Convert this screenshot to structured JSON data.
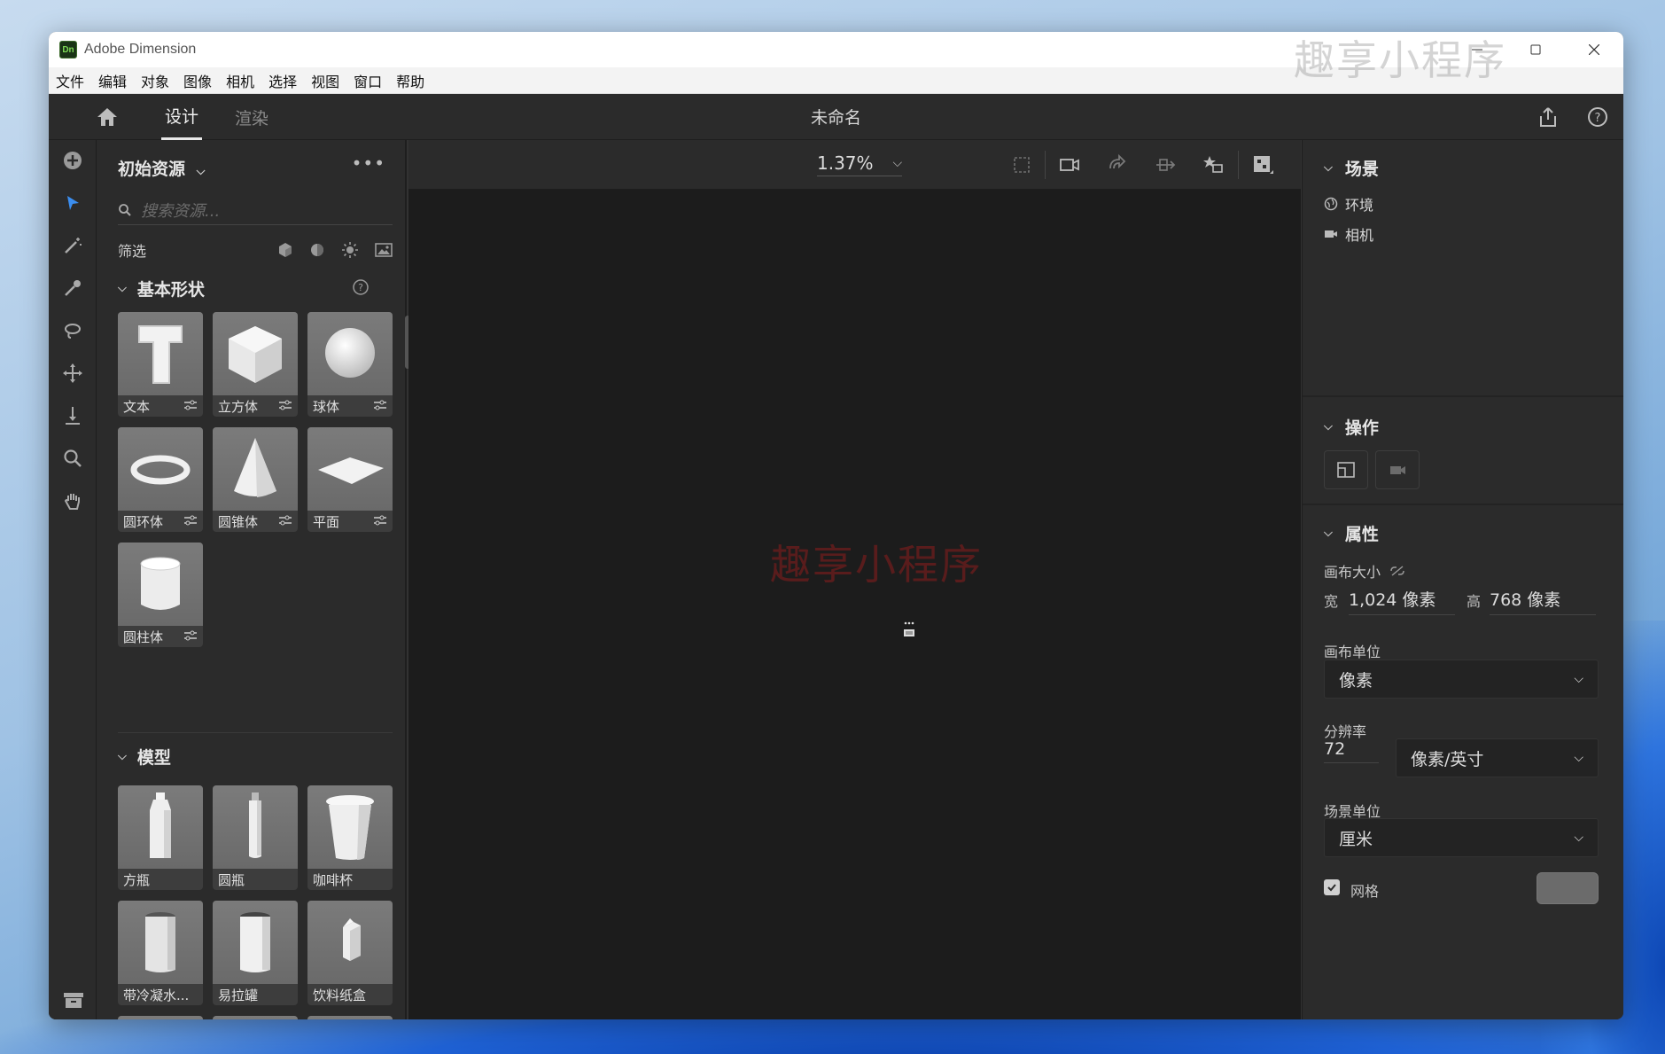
{
  "window": {
    "app_title": "Adobe Dimension",
    "logo_text": "Dn",
    "watermark": "趣享小程序"
  },
  "menu": [
    "文件",
    "编辑",
    "对象",
    "图像",
    "相机",
    "选择",
    "视图",
    "窗口",
    "帮助"
  ],
  "topbar": {
    "tab_design": "设计",
    "tab_render": "渲染",
    "doc_title": "未命名"
  },
  "assets": {
    "title": "初始资源",
    "search_placeholder": "搜索资源...",
    "filter_label": "筛选",
    "basic_shapes": {
      "title": "基本形状",
      "items": [
        {
          "label": "文本"
        },
        {
          "label": "立方体"
        },
        {
          "label": "球体"
        },
        {
          "label": "圆环体"
        },
        {
          "label": "圆锥体"
        },
        {
          "label": "平面"
        },
        {
          "label": "圆柱体"
        }
      ]
    },
    "models": {
      "title": "模型",
      "items": [
        {
          "label": "方瓶"
        },
        {
          "label": "圆瓶"
        },
        {
          "label": "咖啡杯"
        },
        {
          "label": "带冷凝水..."
        },
        {
          "label": "易拉罐"
        },
        {
          "label": "饮料纸盒"
        }
      ]
    }
  },
  "viewport": {
    "zoom": "1.37%",
    "watermark": "趣享小程序"
  },
  "properties": {
    "scene": {
      "title": "场景",
      "environment": "环境",
      "camera": "相机"
    },
    "actions": {
      "title": "操作"
    },
    "attributes": {
      "title": "属性",
      "canvas_size_label": "画布大小",
      "width_label": "宽",
      "width_value": "1,024 像素",
      "height_label": "高",
      "height_value": "768 像素",
      "canvas_unit_label": "画布单位",
      "canvas_unit": "像素",
      "resolution_label": "分辨率",
      "resolution_value": "72",
      "resolution_unit": "像素/英寸",
      "scene_unit_label": "场景单位",
      "scene_unit": "厘米",
      "grid_label": "网格",
      "grid_checked": true
    }
  }
}
